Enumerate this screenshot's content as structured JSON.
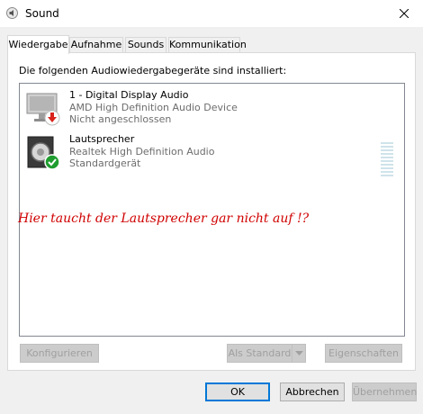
{
  "window": {
    "title": "Sound",
    "close_glyph": "✕"
  },
  "tabs": [
    {
      "label": "Wiedergabe",
      "active": true
    },
    {
      "label": "Aufnahme"
    },
    {
      "label": "Sounds"
    },
    {
      "label": "Kommunikation"
    }
  ],
  "panel": {
    "heading": "Die folgenden Audiowiedergabegeräte sind installiert:"
  },
  "devices": [
    {
      "name": "1 - Digital Display Audio",
      "description": "AMD High Definition Audio Device",
      "status": "Nicht angeschlossen",
      "icon": "monitor-icon",
      "badge": "disconnected-badge-icon"
    },
    {
      "name": "Lautsprecher",
      "description": "Realtek High Definition Audio",
      "status": "Standardgerät",
      "icon": "speaker-icon",
      "badge": "default-check-badge-icon"
    }
  ],
  "annotation": "Hier taucht der Lautsprecher gar nicht auf !?",
  "buttons": {
    "configure": "Konfigurieren",
    "set_default": "Als Standard",
    "properties": "Eigenschaften",
    "ok": "OK",
    "cancel": "Abbrechen",
    "apply": "Übernehmen"
  },
  "colors": {
    "accent": "#0078d7",
    "annotation": "#d00000",
    "ok_badge": "#1f9d2f",
    "error_badge": "#d9221c"
  }
}
